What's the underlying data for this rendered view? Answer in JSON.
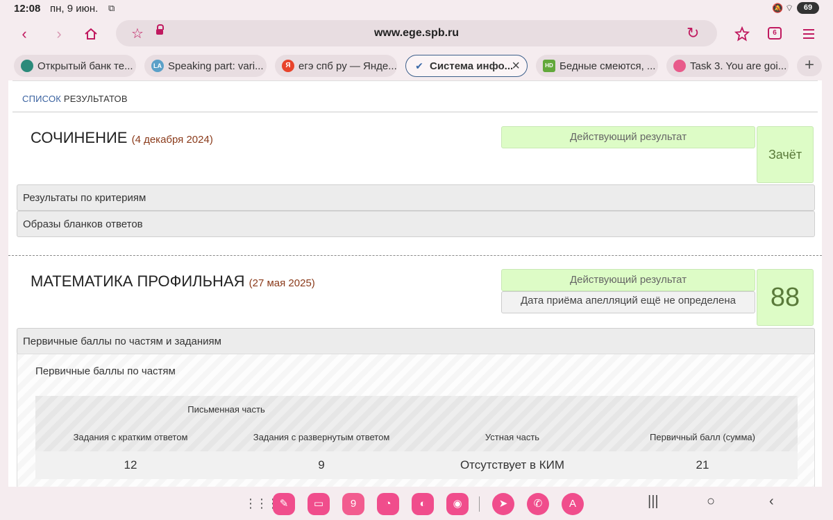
{
  "status_bar": {
    "time": "12:08",
    "date": "пн, 9 июн.",
    "battery": "69"
  },
  "browser": {
    "url": "www.ege.spb.ru",
    "tab_count": "6",
    "tabs": [
      {
        "label": "Открытый банк те...",
        "favicon_color": "#2b8a7a",
        "favicon_text": ""
      },
      {
        "label": "Speaking part: vari...",
        "favicon_color": "#5aa0c8",
        "favicon_text": "LA"
      },
      {
        "label": "егэ спб ру — Янде...",
        "favicon_color": "#e8432b",
        "favicon_text": "Я"
      },
      {
        "label": "Система инфо...",
        "favicon_color": "#3b6aa8",
        "favicon_text": "✔"
      },
      {
        "label": "Бедные смеются, ...",
        "favicon_color": "#62a83b",
        "favicon_text": "HD"
      },
      {
        "label": "Task 3. You are goi...",
        "favicon_color": "#e85a8a",
        "favicon_text": "●"
      }
    ]
  },
  "page": {
    "breadcrumb_a": "СПИСОК",
    "breadcrumb_b": "РЕЗУЛЬТАТОВ",
    "subjects": [
      {
        "title": "СОЧИНЕНИЕ",
        "date": "(4 декабря 2024)",
        "status": "Действующий результат",
        "score": "Зачёт",
        "sections": [
          "Результаты по критериям",
          "Образы бланков ответов"
        ]
      },
      {
        "title": "МАТЕМАТИКА ПРОФИЛЬНАЯ",
        "date": "(27 мая 2025)",
        "status": "Действующий результат",
        "appeal": "Дата приёма апелляций ещё не определена",
        "score": "88",
        "section": "Первичные баллы по частям и заданиям",
        "panel_title": "Первичные баллы по частям",
        "table": {
          "group_header": "Письменная часть",
          "headers": [
            "Задания с кратким ответом",
            "Задания с развернутым ответом",
            "Устная часть",
            "Первичный балл (сумма)"
          ],
          "values": [
            "12",
            "9",
            "Отсутствует в КИМ",
            "21"
          ]
        }
      }
    ]
  }
}
